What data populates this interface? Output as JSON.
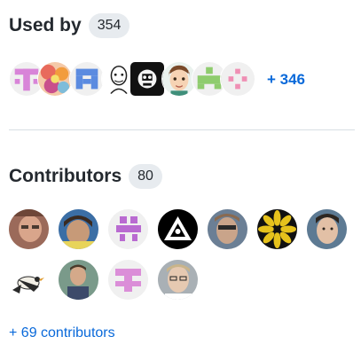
{
  "used_by": {
    "title": "Used by",
    "count": "354",
    "more_link": "+ 346",
    "avatars": [
      {
        "icon": "pink-identicon-avatar"
      },
      {
        "icon": "floral-pattern-avatar"
      },
      {
        "icon": "blue-identicon-avatar"
      },
      {
        "icon": "sketch-portrait-avatar"
      },
      {
        "icon": "black-white-art-avatar"
      },
      {
        "icon": "cartoon-face-avatar"
      },
      {
        "icon": "green-identicon-avatar"
      },
      {
        "icon": "pink-dots-identicon-avatar"
      }
    ]
  },
  "contributors": {
    "title": "Contributors",
    "count": "80",
    "more_link": "+ 69 contributors",
    "avatars": [
      {
        "icon": "contributor-photo-avatar"
      },
      {
        "icon": "contributor-photo-avatar"
      },
      {
        "icon": "purple-identicon-avatar"
      },
      {
        "icon": "triangle-logo-avatar"
      },
      {
        "icon": "contributor-photo-avatar"
      },
      {
        "icon": "yellow-pattern-avatar"
      },
      {
        "icon": "contributor-photo-avatar"
      },
      {
        "icon": "bird-photo-avatar"
      },
      {
        "icon": "contributor-photo-avatar"
      },
      {
        "icon": "pink-identicon-avatar"
      },
      {
        "icon": "contributor-photo-avatar"
      }
    ]
  },
  "colors": {
    "link": "#0969da",
    "badge_bg": "#e7ebef",
    "divider": "#d8dee4"
  }
}
